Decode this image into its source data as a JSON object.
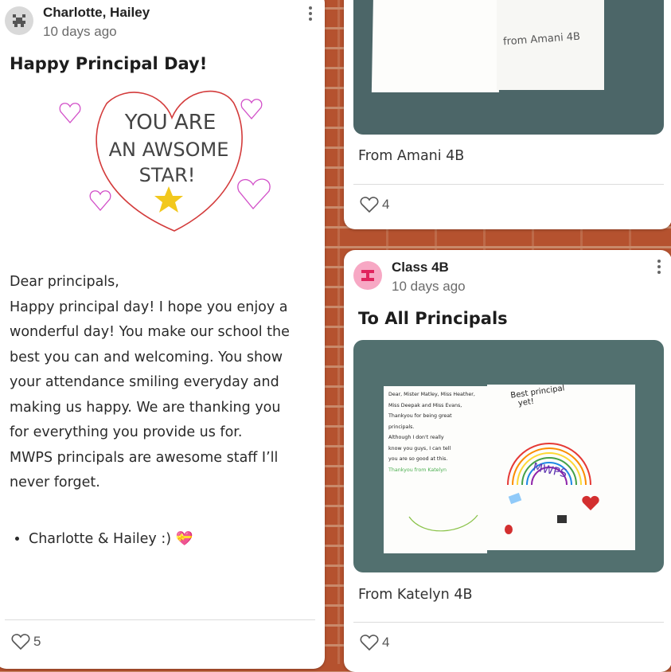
{
  "posts": [
    {
      "author": "Charlotte, Hailey",
      "time": "10 days ago",
      "title": "Happy Principal Day!",
      "drawing_text": [
        "YOU ARE",
        "AN AWSOME",
        "STAR!"
      ],
      "body_lines": [
        "Dear principals,",
        "Happy principal day! I hope you enjoy a",
        "wonderful day!  You make our school the",
        "best you can and welcoming. You show",
        "your attendance smiling everyday and",
        "making us happy. We are thanking you",
        "for everything you provide us for.",
        "MWPS principals are awesome staff I’ll",
        "never forget."
      ],
      "bullet": "Charlotte & Hailey :) 💝",
      "likes": "5"
    },
    {
      "photo_text": "from Amani 4B",
      "caption": "From Amani 4B",
      "likes": "4"
    },
    {
      "author": "Class 4B",
      "time": "10 days ago",
      "title": "To All Principals",
      "letter_lines": [
        "Dear, Mister Matley, Miss Heather,",
        "Miss Deepak and Miss Evans,",
        "Thankyou for being great",
        "principals.",
        "Although I don't really",
        "know you guys, I can tell",
        "you are so good at this.",
        "Thankyou from Katelyn"
      ],
      "card_right_text": [
        "Best principal",
        "yet!"
      ],
      "rainbow_text": "MWPS",
      "caption": "From Katelyn 4B",
      "likes": "4"
    }
  ],
  "colors": {
    "avatar_gray": "#d9d9d9",
    "avatar_pink": "#f7a8c4",
    "heart_red": "#d33b3b",
    "star_yellow": "#f2c81d"
  }
}
